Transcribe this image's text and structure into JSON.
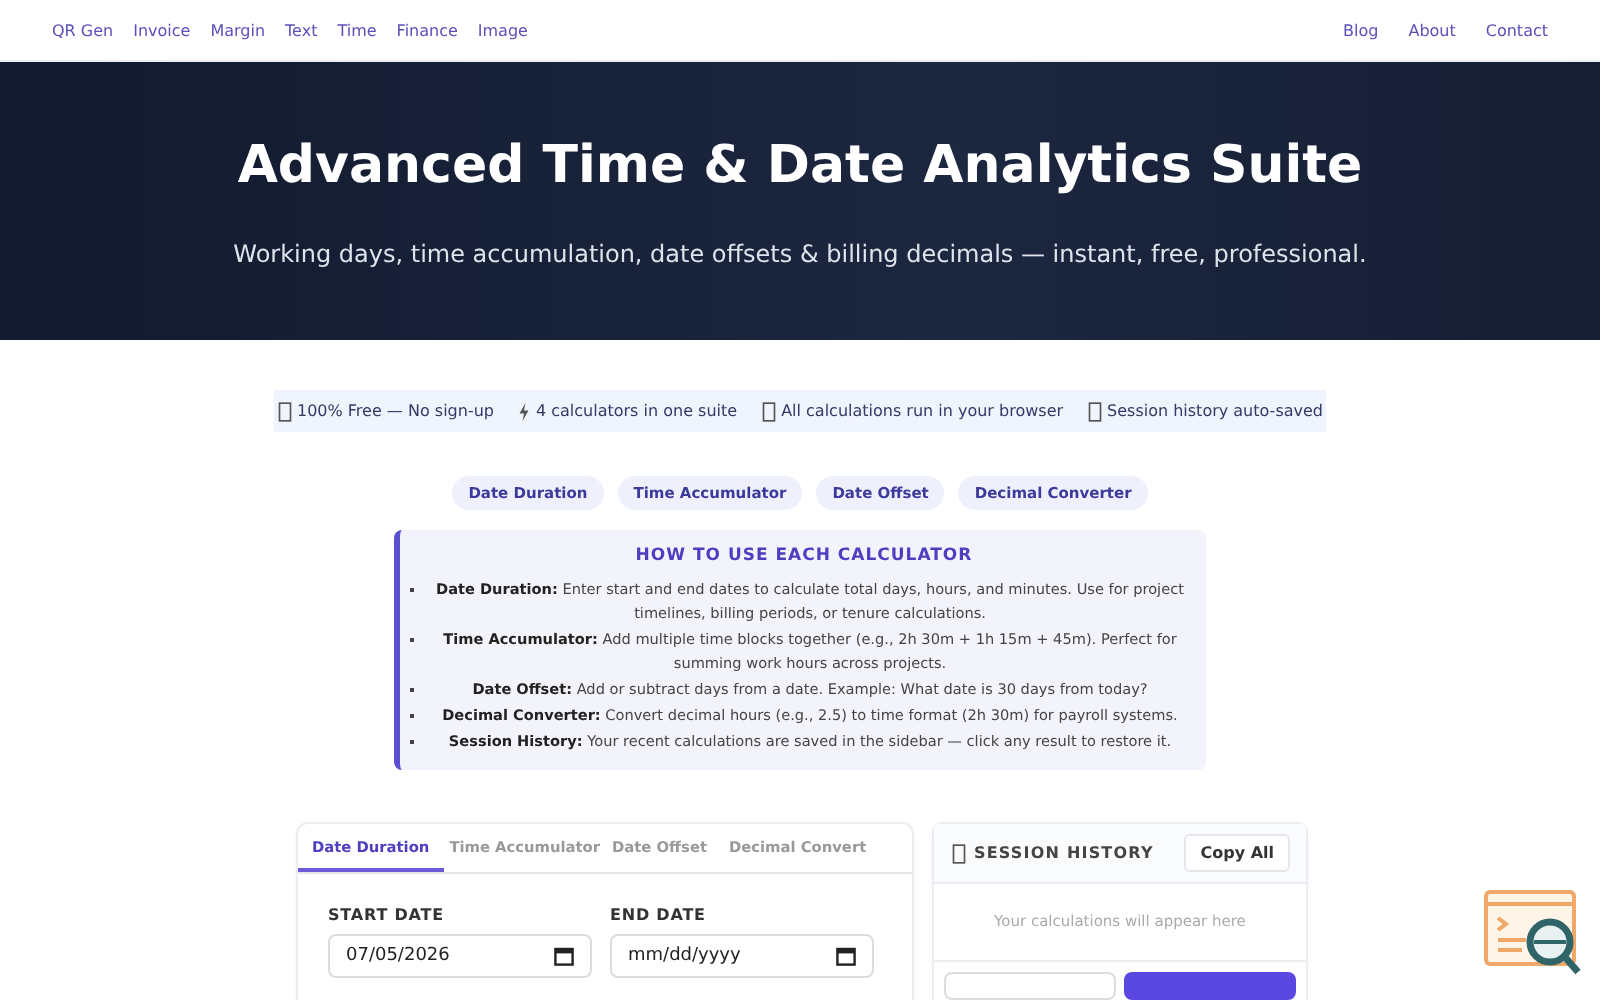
{
  "nav": {
    "left": [
      "QR Gen",
      "Invoice",
      "Margin",
      "Text",
      "Time",
      "Finance",
      "Image"
    ],
    "right": [
      "Blog",
      "About",
      "Contact"
    ]
  },
  "hero": {
    "title": "Advanced Time & Date Analytics Suite",
    "subtitle": "Working days, time accumulation, date offsets & billing decimals — instant, free, professional."
  },
  "features": [
    {
      "text": "100% Free — No sign-up",
      "kind": "box"
    },
    {
      "text": "4 calculators in one suite",
      "kind": "bolt"
    },
    {
      "text": "All calculations run in your browser",
      "kind": "box"
    },
    {
      "text": "Session history auto-saved",
      "kind": "box"
    }
  ],
  "quick_links": [
    "Date Duration",
    "Time Accumulator",
    "Date Offset",
    "Decimal Converter"
  ],
  "howto": {
    "title": "HOW TO USE EACH CALCULATOR",
    "items": [
      {
        "term": "Date Duration:",
        "text": "Enter start and end dates to calculate total days, hours, and minutes. Use for project timelines, billing periods, or tenure calculations."
      },
      {
        "term": "Time Accumulator:",
        "text": "Add multiple time blocks together (e.g., 2h 30m + 1h 15m + 45m). Perfect for summing work hours across projects."
      },
      {
        "term": "Date Offset:",
        "text": "Add or subtract days from a date. Example: What date is 30 days from today?"
      },
      {
        "term": "Decimal Converter:",
        "text": "Convert decimal hours (e.g., 2.5) to time format (2h 30m) for payroll systems."
      },
      {
        "term": "Session History:",
        "text": "Your recent calculations are saved in the sidebar — click any result to restore it."
      }
    ]
  },
  "calculator": {
    "tabs": [
      {
        "label": "Date Duration",
        "selected": true
      },
      {
        "label": "Time Accumulator",
        "selected": false
      },
      {
        "label": "Date Offset",
        "selected": false
      },
      {
        "label": "Decimal Convert",
        "selected": false
      }
    ],
    "fields": [
      {
        "label": "START DATE",
        "value": "07/05/2026"
      },
      {
        "label": "END DATE",
        "placeholder": "mm/dd/yyyy"
      }
    ]
  },
  "history": {
    "title": "SESSION HISTORY",
    "copy_button": "Copy All",
    "empty": "Your calculations will appear here"
  }
}
